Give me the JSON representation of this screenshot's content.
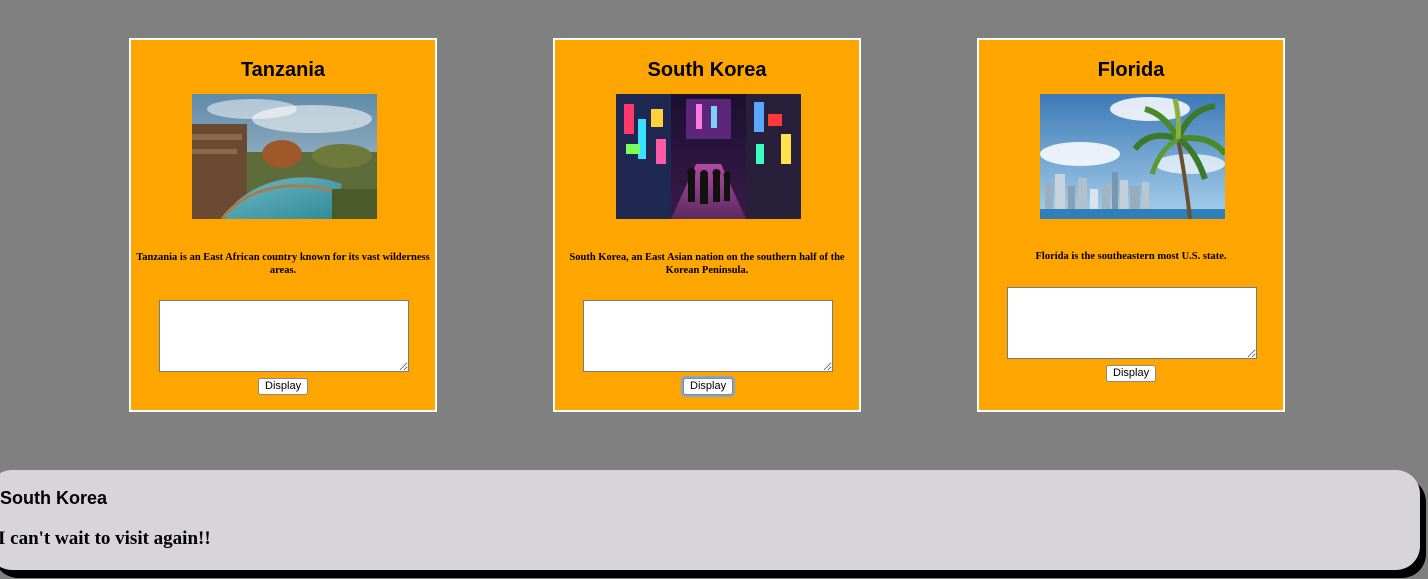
{
  "cards": [
    {
      "title": "Tanzania",
      "image_alt": "Tanzania safari lodge with infinity pool",
      "description": "Tanzania is an East African country known for its vast wilderness areas.",
      "textarea_value": "",
      "button_label": "Display"
    },
    {
      "title": "South Korea",
      "image_alt": "South Korea neon-lit city street at night",
      "description": "South Korea, an East Asian nation on the southern half of the Korean Peninsula.",
      "textarea_value": "",
      "button_label": "Display"
    },
    {
      "title": "Florida",
      "image_alt": "Florida skyline with palm tree",
      "description": "Florida is the southeastern most U.S. state.",
      "textarea_value": "",
      "button_label": "Display"
    }
  ],
  "output_panel": {
    "title": "South Korea",
    "message": "I can't wait to visit again!!"
  },
  "colors": {
    "page_background": "#808080",
    "card_background": "#ffa500",
    "card_border": "#ffffff",
    "panel_background": "#d8d5d9"
  }
}
